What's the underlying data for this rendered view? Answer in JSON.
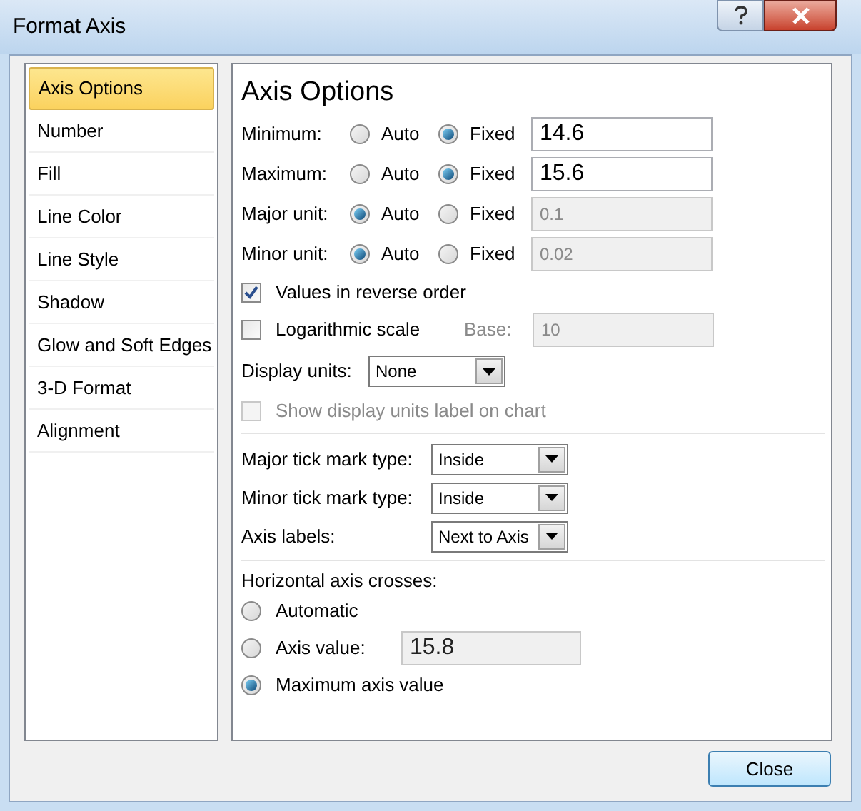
{
  "window": {
    "title": "Format Axis"
  },
  "sidebar": {
    "items": [
      {
        "label": "Axis Options",
        "selected": true
      },
      {
        "label": "Number",
        "selected": false
      },
      {
        "label": "Fill",
        "selected": false
      },
      {
        "label": "Line Color",
        "selected": false
      },
      {
        "label": "Line Style",
        "selected": false
      },
      {
        "label": "Shadow",
        "selected": false
      },
      {
        "label": "Glow and Soft Edges",
        "selected": false
      },
      {
        "label": "3-D Format",
        "selected": false
      },
      {
        "label": "Alignment",
        "selected": false
      }
    ]
  },
  "panel": {
    "heading": "Axis Options",
    "bounds": [
      {
        "label": "Minimum:",
        "options": [
          {
            "label": "Auto",
            "selected": false
          },
          {
            "label": "Fixed",
            "selected": true
          }
        ],
        "value": "14.6",
        "disabled": false
      },
      {
        "label": "Maximum:",
        "options": [
          {
            "label": "Auto",
            "selected": false
          },
          {
            "label": "Fixed",
            "selected": true
          }
        ],
        "value": "15.6",
        "disabled": false
      },
      {
        "label": "Major unit:",
        "options": [
          {
            "label": "Auto",
            "selected": true
          },
          {
            "label": "Fixed",
            "selected": false
          }
        ],
        "value": "0.1",
        "disabled": true
      },
      {
        "label": "Minor unit:",
        "options": [
          {
            "label": "Auto",
            "selected": true
          },
          {
            "label": "Fixed",
            "selected": false
          }
        ],
        "value": "0.02",
        "disabled": true
      }
    ],
    "reverse_order": {
      "label": "Values in reverse order",
      "checked": true,
      "disabled": false
    },
    "log_scale": {
      "label": "Logarithmic scale",
      "checked": false,
      "disabled": false,
      "base_label": "Base:",
      "base_value": "10",
      "base_disabled": true
    },
    "display_units": {
      "label": "Display units:",
      "value": "None"
    },
    "show_units_label": {
      "label": "Show display units label on chart",
      "checked": false,
      "disabled": true
    },
    "tick_settings": [
      {
        "label": "Major tick mark type:",
        "value": "Inside"
      },
      {
        "label": "Minor tick mark type:",
        "value": "Inside"
      },
      {
        "label": "Axis labels:",
        "value": "Next to Axis"
      }
    ],
    "crosses": {
      "heading": "Horizontal axis crosses:",
      "options": [
        {
          "label": "Automatic",
          "selected": false
        },
        {
          "label": "Axis value:",
          "selected": false,
          "value": "15.8"
        },
        {
          "label": "Maximum axis value",
          "selected": true
        }
      ]
    }
  },
  "buttons": [
    {
      "label": "Close"
    }
  ]
}
